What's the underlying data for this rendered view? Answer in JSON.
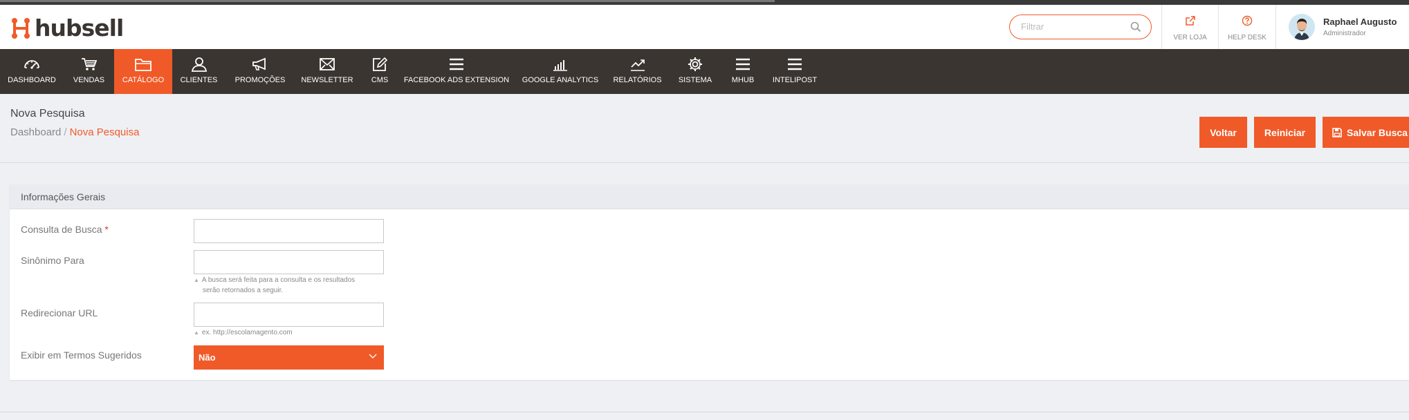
{
  "brand": {
    "name": "hubsell",
    "accent": "#f05a28",
    "nav_bg": "#3b3532"
  },
  "header": {
    "filter_placeholder": "Filtrar",
    "ver_loja": "VER LOJA",
    "help_desk": "HELP DESK",
    "user_name": "Raphael Augusto",
    "user_role": "Administrador"
  },
  "nav": {
    "items": [
      {
        "label": "DASHBOARD",
        "icon": "dashboard-gauge-icon"
      },
      {
        "label": "VENDAS",
        "icon": "cart-icon"
      },
      {
        "label": "CATÁLOGO",
        "icon": "folder-icon",
        "active": true
      },
      {
        "label": "CLIENTES",
        "icon": "user-icon"
      },
      {
        "label": "PROMOÇÕES",
        "icon": "megaphone-icon"
      },
      {
        "label": "NEWSLETTER",
        "icon": "envelope-icon"
      },
      {
        "label": "CMS",
        "icon": "edit-icon"
      },
      {
        "label": "FACEBOOK ADS EXTENSION",
        "icon": "menu-icon"
      },
      {
        "label": "GOOGLE ANALYTICS",
        "icon": "bar-chart-icon"
      },
      {
        "label": "RELATÓRIOS",
        "icon": "trend-line-icon"
      },
      {
        "label": "SISTEMA",
        "icon": "gear-icon"
      },
      {
        "label": "MHUB",
        "icon": "menu-icon"
      },
      {
        "label": "INTELIPOST",
        "icon": "menu-icon"
      }
    ]
  },
  "page": {
    "title": "Nova Pesquisa",
    "breadcrumb_home": "Dashboard",
    "breadcrumb_sep": "/",
    "breadcrumb_current": "Nova Pesquisa",
    "actions": {
      "back": "Voltar",
      "reset": "Reiniciar",
      "save": "Salvar Busca"
    }
  },
  "form": {
    "section_title": "Informações Gerais",
    "query_label": "Consulta de Busca",
    "required_mark": "*",
    "synonym_label": "Sinônimo Para",
    "synonym_note_1": "A busca será feita para a consulta e os resultados",
    "synonym_note_2": "serão retornados a seguir.",
    "redirect_label": "Redirecionar URL",
    "redirect_note": "ex. http://escolamagento.com",
    "suggested_label": "Exibir em Termos Sugeridos",
    "suggested_value": "Não"
  }
}
